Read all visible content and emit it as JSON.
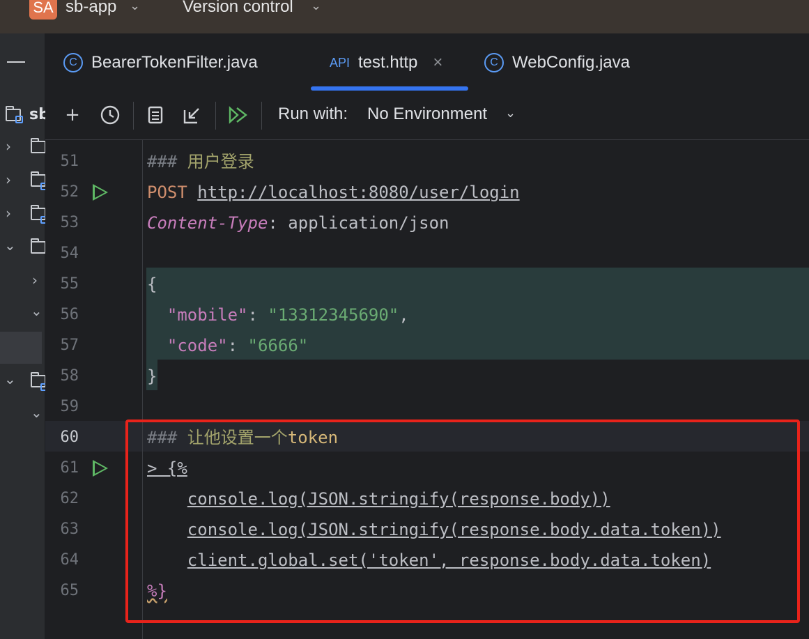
{
  "titlebar": {
    "project_badge": "SA",
    "project_name": "sb-app",
    "vcs_label": "Version control"
  },
  "project_panel": {
    "label": "sb"
  },
  "tabs": [
    {
      "label": "BearerTokenFilter.java",
      "icon": "class-icon",
      "active": false
    },
    {
      "label": "test.http",
      "icon": "api-icon",
      "active": true,
      "icon_text": "API"
    },
    {
      "label": "WebConfig.java",
      "icon": "class-icon",
      "active": false
    }
  ],
  "toolbar": {
    "run_with_label": "Run with:",
    "environment": "No Environment"
  },
  "colors": {
    "accent": "#3574f0",
    "highlight_box": "#e8231b",
    "run_green": "#5fb865"
  },
  "code": {
    "lines": [
      {
        "num": "51",
        "hash": "###",
        "text": " 用户登录"
      },
      {
        "num": "52",
        "method": "POST",
        "url": "http://localhost:8080/user/login"
      },
      {
        "num": "53",
        "header_name": "Content-Type",
        "header_value": ": application/json"
      },
      {
        "num": "54"
      },
      {
        "num": "55",
        "text": "{"
      },
      {
        "num": "56",
        "key": "\"mobile\"",
        "sep": ": ",
        "value": "\"13312345690\"",
        "tail": ","
      },
      {
        "num": "57",
        "key": "\"code\"",
        "sep": ": ",
        "value": "\"6666\""
      },
      {
        "num": "58",
        "text": "}"
      },
      {
        "num": "59"
      },
      {
        "num": "60",
        "hash": "###",
        "text": " 让他设置一个",
        "bold": "token"
      },
      {
        "num": "61",
        "text": "> {%"
      },
      {
        "num": "62",
        "text": "console.log(JSON.stringify(response.body))"
      },
      {
        "num": "63",
        "text": "console.log(JSON.stringify(response.body.data.token))"
      },
      {
        "num": "64",
        "text": "client.global.set('token', response.body.data.token)"
      },
      {
        "num": "65",
        "text": "%}"
      }
    ]
  }
}
